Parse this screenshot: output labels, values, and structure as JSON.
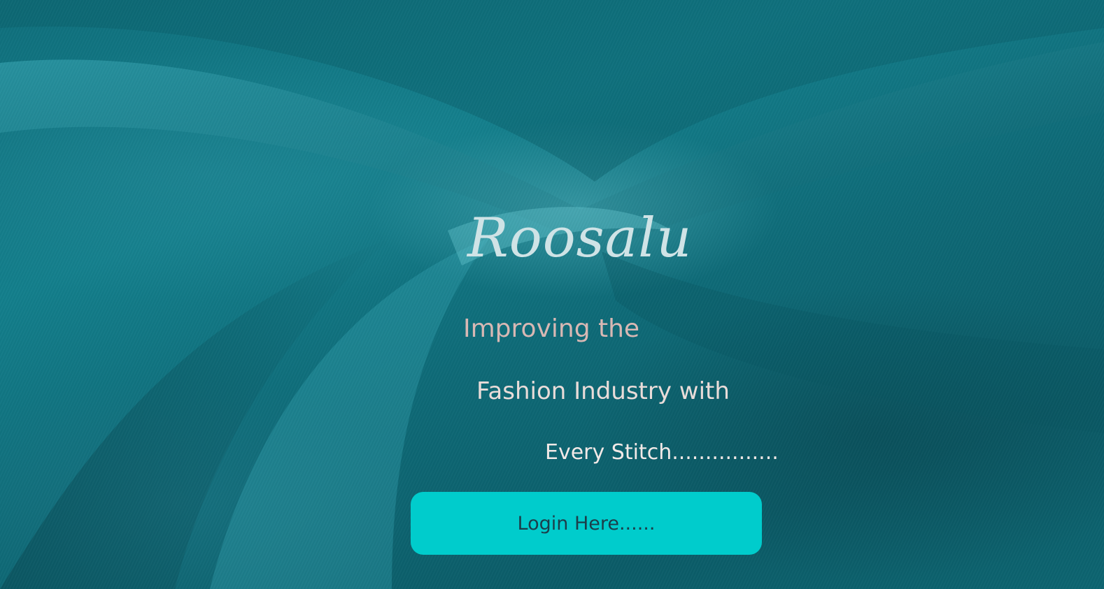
{
  "hero": {
    "brand": "Roosalu",
    "tagline_line1": "Improving the",
    "tagline_line2": "Fashion Industry with",
    "tagline_line3": "Every Stitch................",
    "login_label": "Login Here......"
  },
  "colors": {
    "background": "#0f6f7c",
    "brand_text": "#cfe3e6",
    "button": "#00cccc",
    "button_text": "#1c3e4a"
  }
}
